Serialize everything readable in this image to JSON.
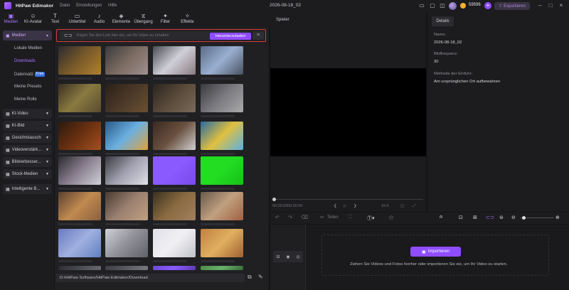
{
  "titlebar": {
    "app_name": "HitPaw Edimakor",
    "menus": [
      "Datei",
      "Einstellungen",
      "Hilfe"
    ],
    "project_name": "2026-08-18_02",
    "coins": "59596",
    "plus": "+",
    "export_label": "Exportieren"
  },
  "toolbar": [
    {
      "label": "Medien",
      "icon": "folder-icon",
      "glyph": "▣"
    },
    {
      "label": "KI-Avatar",
      "icon": "avatar-icon",
      "glyph": "☺"
    },
    {
      "label": "Text",
      "icon": "text-icon",
      "glyph": "T"
    },
    {
      "label": "Untertitel",
      "icon": "subtitle-icon",
      "glyph": "▭"
    },
    {
      "label": "Audio",
      "icon": "audio-icon",
      "glyph": "♪"
    },
    {
      "label": "Elemente",
      "icon": "elements-icon",
      "glyph": "◈"
    },
    {
      "label": "Übergang",
      "icon": "transition-icon",
      "glyph": "⧖"
    },
    {
      "label": "Filter",
      "icon": "filter-icon",
      "glyph": "✦"
    },
    {
      "label": "Effekte",
      "icon": "effects-icon",
      "glyph": "✧"
    }
  ],
  "sidebar": {
    "media_header": "Medien",
    "media_items": [
      "Lokale Medien",
      "Downloads",
      "Datensatz",
      "Meine Presets",
      "Meine Rolle"
    ],
    "free_badge": "Free",
    "sections": [
      "KI-Video",
      "KI-Bild",
      "Gesichtstausch",
      "Videoverstärk...",
      "Bildverbesser...",
      "Stock-Medien",
      "Intelligente B..."
    ]
  },
  "media": {
    "link_placeholder": "Fügen Sie den Link hier ein, um Ihr Video zu erhalten",
    "download_button": "Herunterzuladen",
    "path": "D:/HitPaw Software/HitPaw Edimakor/Download"
  },
  "player": {
    "title": "Spieler",
    "time_current": "00:00:00",
    "time_total": "00:00:00",
    "zoom": "16:9"
  },
  "details": {
    "tab": "Details",
    "name_label": "Name:",
    "name_value": "2026-08-18_02",
    "framerate_label": "Bildfrequenz:",
    "framerate_value": "30",
    "method_label": "Methode der Einfuhr:",
    "method_value": "Am ursprünglichen Ort aufbewahren"
  },
  "timeline": {
    "split_label": "Teilen",
    "import_button": "Importieren",
    "hint": "Ziehen Sie Videos und Fotos hierher oder importieren Sie sie, um Ihr Video zu starten."
  },
  "colors": {
    "accent": "#8f4dff",
    "highlight_border": "#d63d3d",
    "background": "#141416"
  }
}
